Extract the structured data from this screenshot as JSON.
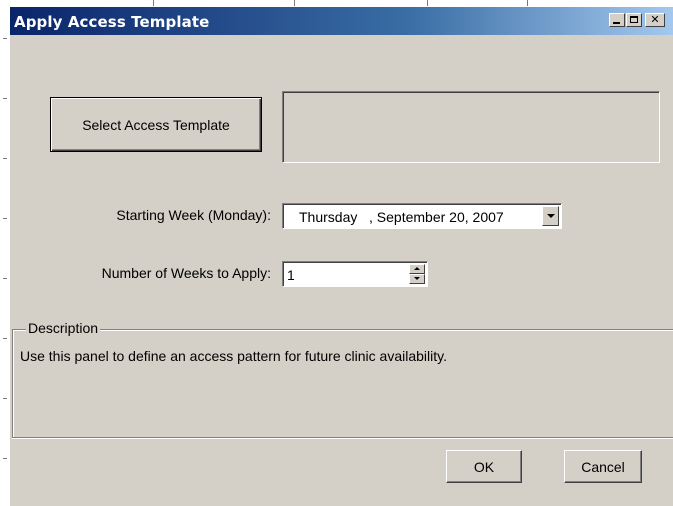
{
  "window": {
    "title": "Apply Access Template",
    "controls": [
      "minimize-icon",
      "maximize-icon",
      "close-icon"
    ]
  },
  "template": {
    "button_label": "Select Access Template",
    "selected_value": ""
  },
  "starting_week": {
    "label": "Starting Week (Monday):",
    "value": "Thursday   , September 20, 2007"
  },
  "weeks": {
    "label": "Number of Weeks to Apply:",
    "value": "1"
  },
  "description": {
    "legend": "Description",
    "text": "Use this panel to define an access pattern for future clinic availability."
  },
  "actions": {
    "ok_label": "OK",
    "cancel_label": "Cancel"
  },
  "colors": {
    "dialog_bg": "#d4d0c8",
    "titlebar_start": "#0a246a",
    "titlebar_end": "#a6caf0"
  }
}
